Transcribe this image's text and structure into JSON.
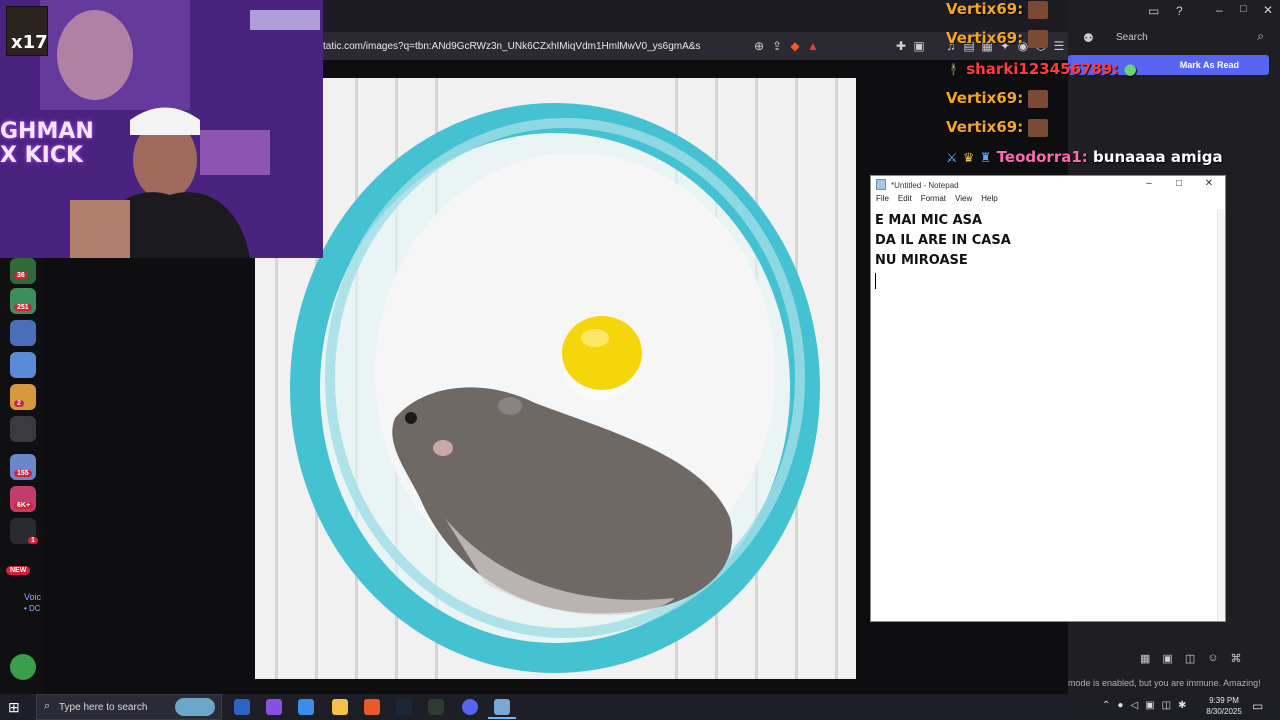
{
  "browser": {
    "url": "tatic.com/images?q=tbn:ANd9GcRWz3n_UNk6CZxhIMiqVdm1HmlMwV0_ys6gmA&s"
  },
  "webcam": {
    "badge": "x17",
    "banner": "GHMAN X KICK"
  },
  "left_rail": {
    "counts": [
      "36",
      "251",
      "2",
      "155",
      "6K+",
      "1"
    ],
    "new_label": "NEW",
    "voice_label": "Voic",
    "voice_sub": "• DC"
  },
  "chat": {
    "lines": [
      {
        "user": "Vertix69:",
        "text": ""
      },
      {
        "user": "Vertix69:",
        "text": ""
      },
      {
        "user": "sharki123456789:",
        "text": ""
      },
      {
        "user": "Vertix69:",
        "text": ""
      },
      {
        "user": "Vertix69:",
        "text": ""
      },
      {
        "user": "Teodorra1:",
        "text": "bunaaaa amiga"
      }
    ],
    "colors": {
      "vertix": "#f5a623",
      "sharki": "#ff3b3b",
      "teodorra": "#ff69b4"
    }
  },
  "right_panel": {
    "search_label": "Search",
    "mark_read": "Mark As Read",
    "immune_text": "mode is enabled, but you are immune. Amazing!"
  },
  "notepad": {
    "title": "*Untitled - Notepad",
    "menu": [
      "File",
      "Edit",
      "Format",
      "View",
      "Help"
    ],
    "lines": [
      "E MAI MIC ASA",
      "DA IL ARE IN CASA",
      "NU MIROASE"
    ]
  },
  "taskbar": {
    "search_placeholder": "Type here to search",
    "time": "9:39 PM",
    "date": "8/30/2025"
  }
}
